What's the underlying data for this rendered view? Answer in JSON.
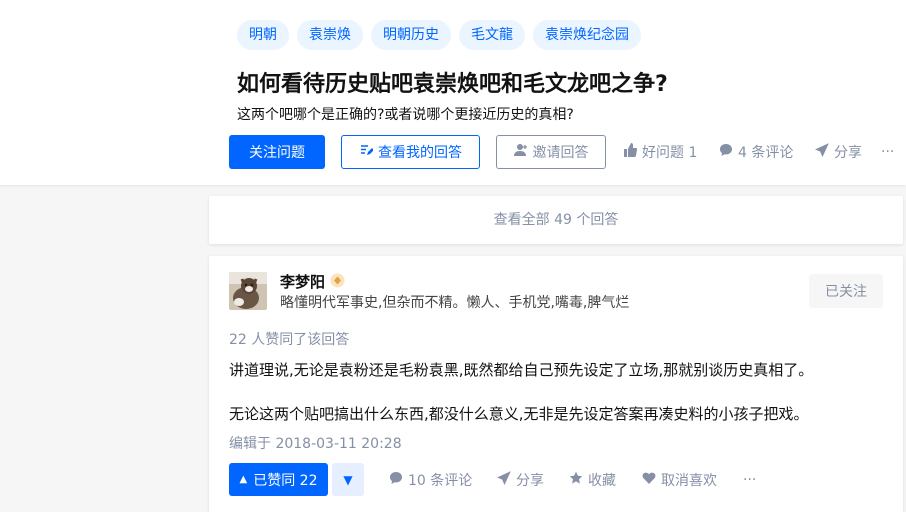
{
  "question": {
    "topics": [
      "明朝",
      "袁崇焕",
      "明朝历史",
      "毛文龍",
      "袁崇焕纪念园"
    ],
    "title": "如何看待历史贴吧袁崇焕吧和毛文龙吧之争?",
    "detail": "这两个吧哪个是正确的?或者说哪个更接近历史的真相?",
    "actions": {
      "follow_label": "关注问题",
      "my_answer_label": "查看我的回答",
      "invite_label": "邀请回答",
      "good_question_label": "好问题 1",
      "comments_label": "4 条评论",
      "share_label": "分享",
      "more_label": "···"
    }
  },
  "view_all_label": "查看全部 49 个回答",
  "answer": {
    "author_name": "李梦阳",
    "author_bio": "略懂明代军事史,但杂而不精。懒人、手机党,嘴毒,脾气烂",
    "followed_label": "已关注",
    "votes_text": "22 人赞同了该回答",
    "paragraphs": [
      "讲道理说,无论是袁粉还是毛粉袁黑,既然都给自己预先设定了立场,那就别谈历史真相了。",
      "无论这两个贴吧搞出什么东西,都没什么意义,无非是先设定答案再凑史料的小孩子把戏。"
    ],
    "edited_text": "编辑于 2018-03-11 20:28",
    "vote_up_label": "已赞同 22",
    "vote_up_arrow": "▲",
    "vote_down_arrow": "▼",
    "comments_label": "10 条评论",
    "share_label": "分享",
    "collect_label": "收藏",
    "unlike_label": "取消喜欢",
    "more_label": "···"
  },
  "colors": {
    "brand_blue": "#0066ff",
    "muted_gray": "#8590a6",
    "topic_bg": "#ebf5ff"
  }
}
